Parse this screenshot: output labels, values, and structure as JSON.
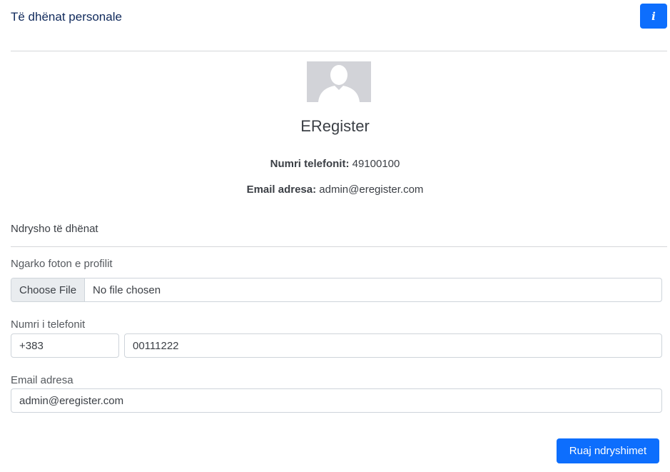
{
  "header": {
    "title": "Të dhënat personale",
    "info_button_label": "i"
  },
  "profile": {
    "name": "ERegister",
    "phone_label": "Numri telefonit:",
    "phone_value": "49100100",
    "email_label": "Email adresa:",
    "email_value": "admin@eregister.com"
  },
  "edit_section": {
    "title": "Ndrysho të dhënat",
    "photo_label": "Ngarko foton e profilit",
    "file_button_label": "Choose File",
    "file_status": "No file chosen",
    "phone_label": "Numri i telefonit",
    "phone_prefix_value": "+383",
    "phone_number_value": "00111222",
    "email_label": "Email adresa",
    "email_value": "admin@eregister.com",
    "save_button_label": "Ruaj ndryshimet"
  },
  "colors": {
    "accent": "#0d6efd",
    "title": "#102a5c",
    "avatar_bg": "#d2d3d8"
  }
}
